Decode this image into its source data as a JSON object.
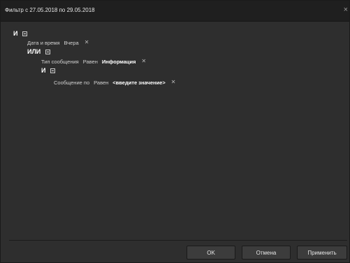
{
  "window": {
    "title": "Фильтр с 27.05.2018 по 29.05.2018",
    "close_glyph": "×"
  },
  "filter": {
    "root_operator": "И",
    "date_condition": {
      "field": "Дата и время",
      "value": "Вчера"
    },
    "or_group": {
      "operator": "ИЛИ",
      "type_condition": {
        "field": "Тип сообщения",
        "comparison": "Равен",
        "value": "Информация"
      },
      "and_group": {
        "operator": "И",
        "message_condition": {
          "field": "Сообщение по",
          "comparison": "Равен",
          "value": "<введите значение>"
        }
      }
    },
    "remove_glyph": "✕"
  },
  "buttons": {
    "ok_label": "OK",
    "cancel_label": "Отмена",
    "apply_label": "Применить"
  }
}
